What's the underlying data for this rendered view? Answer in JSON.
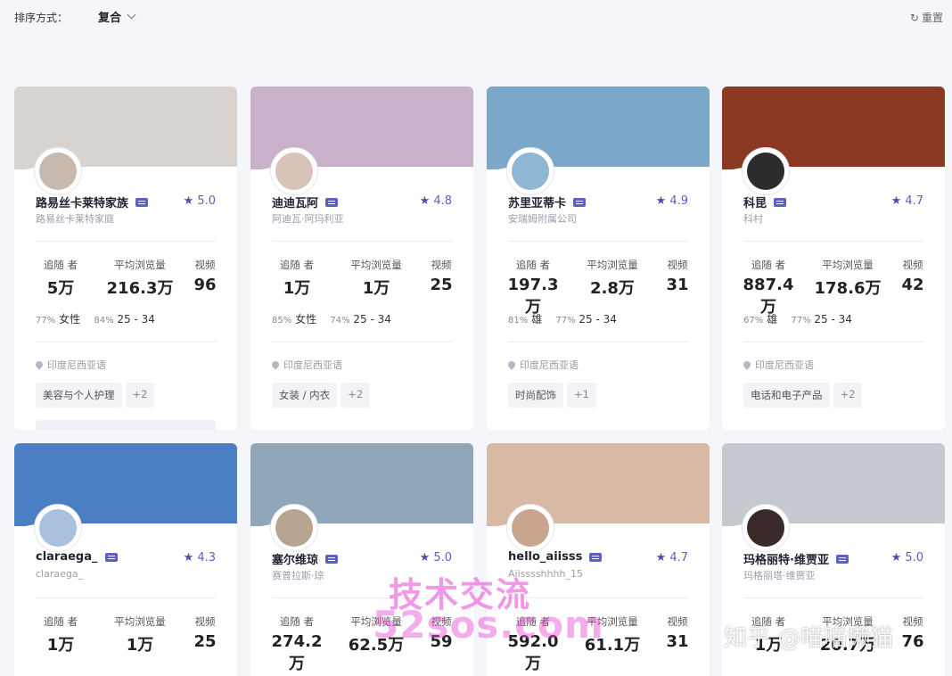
{
  "toolbar": {
    "sort_label": "排序方式：",
    "sort_value": "复合",
    "reset_label": "重置"
  },
  "cards": [
    {
      "name": "路易丝卡莱特家族",
      "subname": "路易丝卡莱特家庭",
      "rating": "5.0",
      "stat_labels": [
        "追随 者",
        "平均浏览量",
        "视频"
      ],
      "followers": "5万",
      "avg_views": "216.3万",
      "videos": "96",
      "gender_pct": "77%",
      "gender": "女性",
      "age_pct": "84%",
      "age": "25 - 34",
      "location": "印度尼西亚语",
      "tags": [
        "美容与个人护理",
        "+2"
      ],
      "cover_color": "#d9d3cf",
      "avatar_color": "#c8b9ae"
    },
    {
      "name": "迪迪瓦阿",
      "subname": "阿迪瓦·阿玛利亚",
      "rating": "4.8",
      "stat_labels": [
        "追随 者",
        "平均浏览量",
        "视频"
      ],
      "followers": "1万",
      "avg_views": "1万",
      "videos": "25",
      "gender_pct": "85%",
      "gender": "女性",
      "age_pct": "74%",
      "age": "25 - 34",
      "location": "印度尼西亚语",
      "tags": [
        "女装 / 内衣",
        "+2"
      ],
      "cover_color": "#c9b1c9",
      "avatar_color": "#d7c3b8"
    },
    {
      "name": "苏里亚蒂卡",
      "subname": "安瑞姆附属公司",
      "rating": "4.9",
      "stat_labels": [
        "追随 者",
        "平均浏览量",
        "视频"
      ],
      "followers": "197.3万",
      "avg_views": "2.8万",
      "videos": "31",
      "gender_pct": "81%",
      "gender": "雄",
      "age_pct": "77%",
      "age": "25 - 34",
      "location": "印度尼西亚语",
      "tags": [
        "时尚配饰",
        "+1"
      ],
      "cover_color": "#7ba7c9",
      "avatar_color": "#8fb6d3"
    },
    {
      "name": "科昆",
      "subname": "科村",
      "rating": "4.7",
      "stat_labels": [
        "追随 者",
        "平均浏览量",
        "视频"
      ],
      "followers": "887.4万",
      "avg_views": "178.6万",
      "videos": "42",
      "gender_pct": "67%",
      "gender": "雄",
      "age_pct": "77%",
      "age": "25 - 34",
      "location": "印度尼西亚语",
      "tags": [
        "电话和电子产品",
        "+2"
      ],
      "cover_color": "#8a3a22",
      "avatar_color": "#2c2c2c"
    },
    {
      "name": "claraega_",
      "subname": "claraega_",
      "rating": "4.3",
      "stat_labels": [
        "追随 者",
        "平均浏览量",
        "视频"
      ],
      "followers": "1万",
      "avg_views": "1万",
      "videos": "25",
      "cover_color": "#4b7fc4",
      "avatar_color": "#a9c1dc"
    },
    {
      "name": "塞尔维琼",
      "subname": "赛普拉斯·琼",
      "rating": "5.0",
      "stat_labels": [
        "追随 者",
        "平均浏览量",
        "视频"
      ],
      "followers": "274.2万",
      "avg_views": "62.5万",
      "videos": "59",
      "cover_color": "#8fa7b8",
      "avatar_color": "#b7a590"
    },
    {
      "name": "hello_aiisss",
      "subname": "Aiisssshhhh_15",
      "rating": "4.7",
      "stat_labels": [
        "追随 者",
        "平均浏览量",
        "视频"
      ],
      "followers": "592.0万",
      "avg_views": "61.1万",
      "videos": "31",
      "cover_color": "#d8b9a3",
      "avatar_color": "#c9a58f"
    },
    {
      "name": "玛格丽特·维贾亚",
      "subname": "玛格丽塔·维贾亚",
      "rating": "5.0",
      "stat_labels": [
        "追随 者",
        "平均浏览量",
        "视频"
      ],
      "followers": "1万",
      "avg_views": "20.7万",
      "videos": "76",
      "cover_color": "#c7c9d0",
      "avatar_color": "#3b2a2a"
    }
  ],
  "watermarks": [
    "技术交流",
    "52sos.com",
    "知乎 @喵喵懒猫"
  ]
}
